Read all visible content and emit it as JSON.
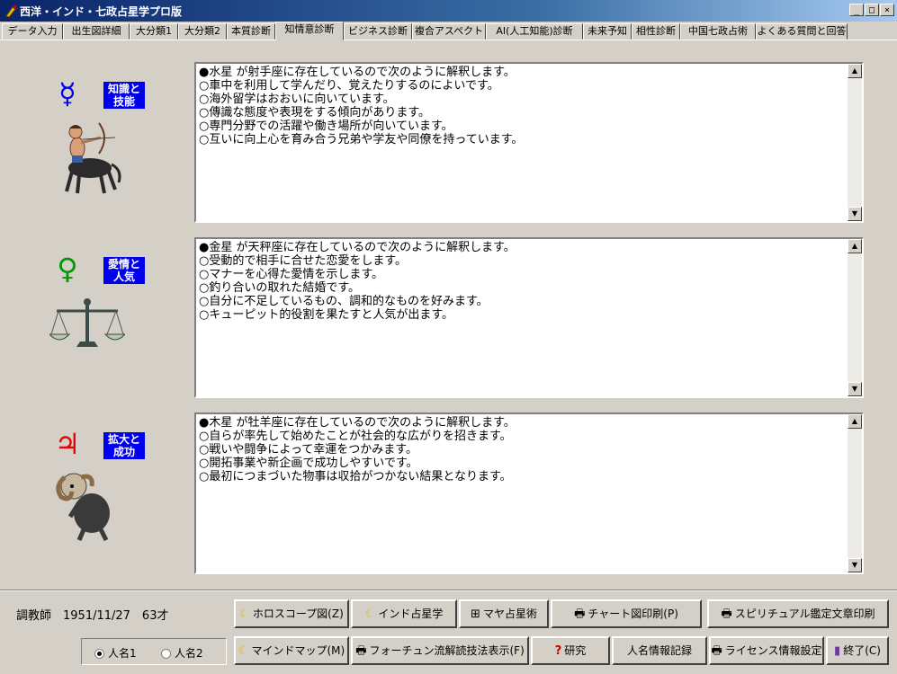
{
  "window": {
    "title": "西洋・インド・七政占星学プロ版",
    "min_glyph": "_",
    "max_glyph": "□",
    "close_glyph": "×"
  },
  "tabs": [
    {
      "label": "データ入力"
    },
    {
      "label": "出生図詳細"
    },
    {
      "label": "大分類1"
    },
    {
      "label": "大分類2"
    },
    {
      "label": "本質診断"
    },
    {
      "label": "知情意診断",
      "active": true
    },
    {
      "label": "ビジネス診断"
    },
    {
      "label": "複合アスペクト"
    },
    {
      "label": "AI(人工知能)診断"
    },
    {
      "label": "未来予知"
    },
    {
      "label": "相性診断"
    },
    {
      "label": "中国七政占術"
    },
    {
      "label": "よくある質問と回答"
    }
  ],
  "sections": [
    {
      "planet_glyph": "☿",
      "planet_color": "#0000ee",
      "label_line1": "知識と",
      "label_line2": "技能",
      "image_icon": "sagittarius-icon",
      "lines": [
        "●水星 が射手座に存在しているので次のように解釈します。",
        "○車中を利用して学んだり、覚えたりするのによいです。",
        "○海外留学はおおいに向いています。",
        "○傳識な態度や表現をする傾向があります。",
        "○専門分野での活躍や働き場所が向いています。",
        "○互いに向上心を育み合う兄弟や学友や同僚を持っています。"
      ]
    },
    {
      "planet_glyph": "♀",
      "planet_color": "#009900",
      "label_line1": "愛情と",
      "label_line2": "人気",
      "image_icon": "libra-icon",
      "lines": [
        "●金星 が天秤座に存在しているので次のように解釈します。",
        "○受動的で相手に合せた恋愛をします。",
        "○マナーを心得た愛情を示します。",
        "○釣り合いの取れた結婚です。",
        "○自分に不足しているもの、調和的なものを好みます。",
        "○キューピット的役割を果たすと人気が出ます。"
      ]
    },
    {
      "planet_glyph": "♃",
      "planet_color": "#ee0000",
      "label_line1": "拡大と",
      "label_line2": "成功",
      "image_icon": "aries-icon",
      "lines": [
        "●木星 が牡羊座に存在しているので次のように解釈します。",
        "○自らが率先して始めたことが社会的な広がりを招きます。",
        "○戦いや闘争によって幸運をつかみます。",
        "○開拓事業や新企画で成功しやすいです。",
        "○最初につまづいた物事は収拾がつかない結果となります。"
      ]
    }
  ],
  "bottom": {
    "client_info": "調教師　1951/11/27　63才",
    "radio1": "人名1",
    "radio2": "人名2",
    "radio_selected": "人名1",
    "buttons_row1": [
      {
        "name": "horoscope-button",
        "label": "ホロスコープ図(Z)",
        "icon": "moon-icon"
      },
      {
        "name": "indian-astrology-button",
        "label": "インド占星学",
        "icon": "moon-icon"
      },
      {
        "name": "maya-astrology-button",
        "label": "マヤ占星術",
        "icon": "maya-icon"
      },
      {
        "name": "chart-print-button",
        "label": "チャート図印刷(P)",
        "icon": "printer-icon"
      },
      {
        "name": "spiritual-print-button",
        "label": "スピリチュアル鑑定文章印刷",
        "icon": "printer-icon"
      }
    ],
    "buttons_row2": [
      {
        "name": "mind-map-button",
        "label": "マインドマップ(M)",
        "icon": "moon-icon"
      },
      {
        "name": "fortune-display-button",
        "label": "フォーチュン流解読技法表示(F)",
        "icon": "printer-icon"
      },
      {
        "name": "research-button",
        "label": "研究",
        "icon": "question-icon"
      },
      {
        "name": "person-record-button",
        "label": "人名情報記録",
        "icon": ""
      },
      {
        "name": "license-settings-button",
        "label": "ライセンス情報設定",
        "icon": "printer-icon"
      },
      {
        "name": "exit-button",
        "label": "終了(C)",
        "icon": "door-icon"
      }
    ]
  }
}
